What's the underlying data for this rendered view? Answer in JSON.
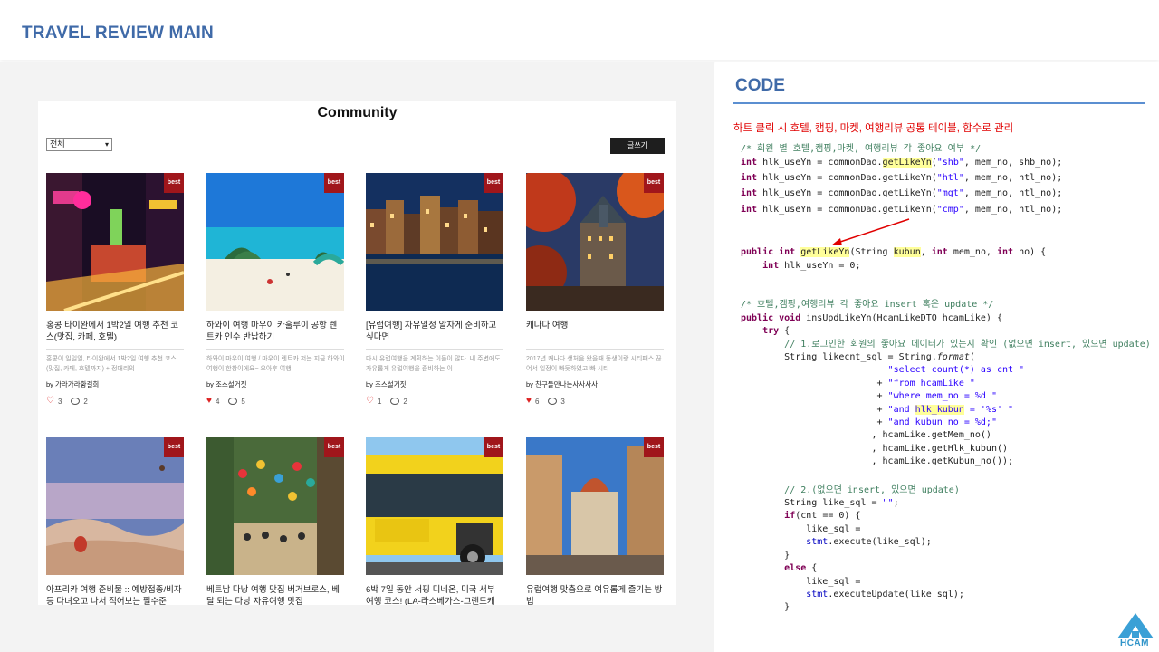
{
  "header": {
    "title": "TRAVEL REVIEW MAIN"
  },
  "community": {
    "title": "Community",
    "filter": {
      "selected": "전체"
    },
    "write_button": "글쓰기",
    "best_label": "best",
    "cards": [
      {
        "title": "홍콩 타이완에서 1박2일 여행 추천 코스(맛집, 카페, 호텔)",
        "excerpt": "홍콩이 일일일, 타이완에서 1박2일 여행 추천 코스 (맛집, 카페, 호텔까지) + 정대리의",
        "author": "by 가라가라황걸희",
        "likes": "3",
        "comments": "2",
        "liked": false,
        "photo": "hongkong"
      },
      {
        "title": "하와이 여행 마우이 카훌루이 공항 렌트카 인수 반납하기",
        "excerpt": "하와이 마우이 여행 / 마우이 렌트카 저는 지금 하와이 여행이 한창이에요~ 오아후 여행",
        "author": "by 조스설거짓",
        "likes": "4",
        "comments": "5",
        "liked": true,
        "photo": "beach"
      },
      {
        "title": "[유럽여행] 자유일정 알차게 준비하고 싶다면",
        "excerpt": "다시 유럽여행을 계획하는 이들이 많다. 내 주변에도 자유롭게 유럽여행을 준비하는 이",
        "author": "by 조스설거짓",
        "likes": "1",
        "comments": "2",
        "liked": false,
        "photo": "amsterdam"
      },
      {
        "title": "캐나다 여행",
        "excerpt": "2017년 캐나다 생처음 왔을때 동생이랑 시티패스 끊어서 일정이 빠듯하였고 빠 시티",
        "author": "by 친구들만나는사사사사",
        "likes": "6",
        "comments": "3",
        "liked": true,
        "photo": "canada"
      },
      {
        "title": "아프리카 여행 준비물 :: 예방접종/비자 등 다녀오고 나서 적어보는 필수준",
        "excerpt": "",
        "author": "",
        "likes": "",
        "comments": "",
        "liked": false,
        "photo": "desert"
      },
      {
        "title": "베트남 다낭 여행 맛집 버거브로스, 베달 되는 다낭 자유여행 맛집",
        "excerpt": "",
        "author": "",
        "likes": "",
        "comments": "",
        "liked": false,
        "photo": "vietnam"
      },
      {
        "title": "6박 7일 동안 서핑 디네온, 미국 서부 여행 코스! (LA-라스베가스-그랜드캐",
        "excerpt": "",
        "author": "",
        "likes": "",
        "comments": "",
        "liked": false,
        "photo": "bus"
      },
      {
        "title": "유럽여행 맛춤으로 여유롭게 즐기는 방법",
        "excerpt": "",
        "author": "",
        "likes": "",
        "comments": "",
        "liked": false,
        "photo": "florence"
      }
    ]
  },
  "code_panel": {
    "title": "CODE",
    "description": "하트 클릭 시 호텔, 캠핑, 마켓, 여행리뷰 공통 테이블, 함수로 관리"
  },
  "colors": {
    "heading_blue": "#3f6aa8",
    "best_red": "#a0161b",
    "description_red": "#e00000",
    "keyword": "#7f0055",
    "comment_green": "#3f7f5f",
    "string_blue": "#2a00ff",
    "highlight": "#ffff9a"
  },
  "brand": {
    "name": "HCAM"
  }
}
